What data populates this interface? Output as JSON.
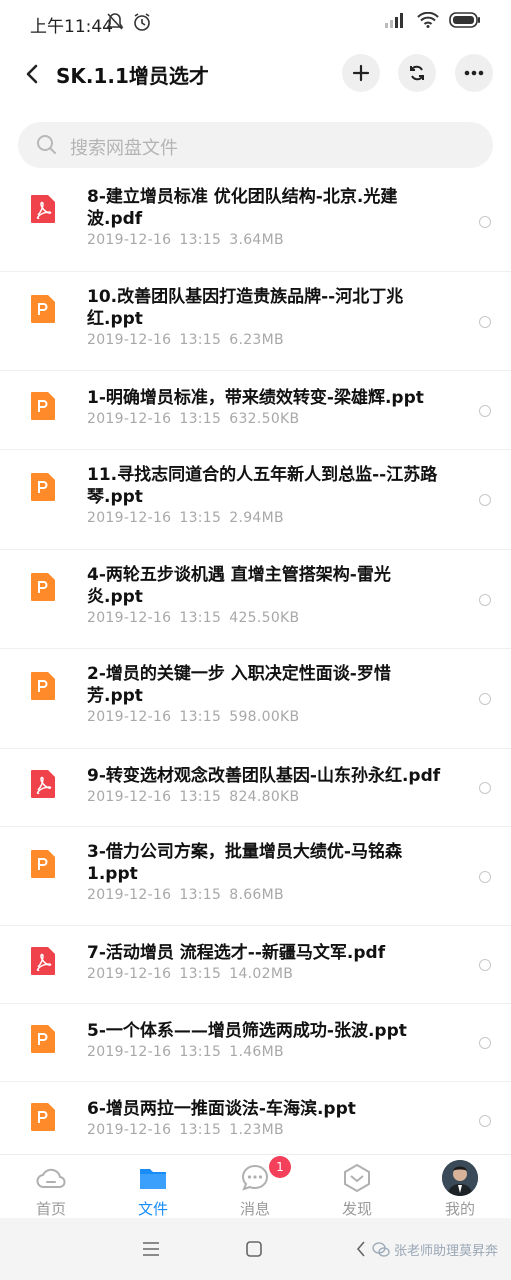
{
  "status_bar": {
    "time": "上午11:44",
    "icons": [
      "dnd-icon",
      "alarm-icon",
      "signal-icon",
      "wifi-icon",
      "battery-icon"
    ]
  },
  "header": {
    "title": "SK.1.1增员选才",
    "actions": [
      "add-icon",
      "refresh-icon",
      "more-icon"
    ]
  },
  "search": {
    "placeholder": "搜索网盘文件"
  },
  "files": [
    {
      "name": "8-建立增员标准 优化团队结构-北京.光建波.pdf",
      "name_lines": [
        "8-建立增员标准 优化团队结构-北京.光建",
        "波.pdf"
      ],
      "type": "pdf",
      "date": "2019-12-16",
      "time": "13:15",
      "size": "3.64MB"
    },
    {
      "name": "10.改善团队基因打造贵族品牌--河北丁兆红.ppt",
      "name_lines": [
        "10.改善团队基因打造贵族品牌--河北丁兆",
        "红.ppt"
      ],
      "type": "ppt",
      "date": "2019-12-16",
      "time": "13:15",
      "size": "6.23MB"
    },
    {
      "name": "1-明确增员标准，带来绩效转变-梁雄辉.ppt",
      "name_lines": [
        "1-明确增员标准，带来绩效转变-梁雄辉.ppt"
      ],
      "type": "ppt",
      "date": "2019-12-16",
      "time": "13:15",
      "size": "632.50KB"
    },
    {
      "name": "11.寻找志同道合的人五年新人到总监--江苏路琴.ppt",
      "name_lines": [
        "11.寻找志同道合的人五年新人到总监--江苏路",
        "琴.ppt"
      ],
      "type": "ppt",
      "date": "2019-12-16",
      "time": "13:15",
      "size": "2.94MB"
    },
    {
      "name": "4-两轮五步谈机遇 直增主管搭架构-雷光炎.ppt",
      "name_lines": [
        "4-两轮五步谈机遇 直增主管搭架构-雷光",
        "炎.ppt"
      ],
      "type": "ppt",
      "date": "2019-12-16",
      "time": "13:15",
      "size": "425.50KB"
    },
    {
      "name": "2-增员的关键一步 入职决定性面谈-罗惜芳.ppt",
      "name_lines": [
        "2-增员的关键一步 入职决定性面谈-罗惜",
        "芳.ppt"
      ],
      "type": "ppt",
      "date": "2019-12-16",
      "time": "13:15",
      "size": "598.00KB"
    },
    {
      "name": "9-转变选材观念改善团队基因-山东孙永红.pdf",
      "name_lines": [
        "9-转变选材观念改善团队基因-山东孙永红.pdf"
      ],
      "type": "pdf",
      "date": "2019-12-16",
      "time": "13:15",
      "size": "824.80KB"
    },
    {
      "name": "3-借力公司方案，批量增员大绩优-马铭森1.ppt",
      "name_lines": [
        "3-借力公司方案，批量增员大绩优-马铭森",
        "1.ppt"
      ],
      "type": "ppt",
      "date": "2019-12-16",
      "time": "13:15",
      "size": "8.66MB"
    },
    {
      "name": "7-活动增员 流程选才--新疆马文军.pdf",
      "name_lines": [
        "7-活动增员 流程选才--新疆马文军.pdf"
      ],
      "type": "pdf",
      "date": "2019-12-16",
      "time": "13:15",
      "size": "14.02MB"
    },
    {
      "name": "5-一个体系——增员筛选两成功-张波.ppt",
      "name_lines": [
        "5-一个体系——增员筛选两成功-张波.ppt"
      ],
      "type": "ppt",
      "date": "2019-12-16",
      "time": "13:15",
      "size": "1.46MB"
    },
    {
      "name": "6-增员两拉一推面谈法-车海滨.ppt",
      "name_lines": [
        "6-增员两拉一推面谈法-车海滨.ppt"
      ],
      "type": "ppt",
      "date": "2019-12-16",
      "time": "13:15",
      "size": "1.23MB"
    }
  ],
  "tabs": [
    {
      "label": "首页",
      "icon": "cloud-icon",
      "active": false
    },
    {
      "label": "文件",
      "icon": "folder-icon",
      "active": true
    },
    {
      "label": "消息",
      "icon": "message-icon",
      "active": false
    },
    {
      "label": "发现",
      "icon": "discover-icon",
      "active": false
    },
    {
      "label": "我的",
      "icon": "avatar",
      "active": false
    }
  ],
  "badge_count": "1",
  "watermark": "张老师助理莫昇奔",
  "colors": {
    "accent": "#1a8cf7",
    "pdf": "#f0424b",
    "ppt": "#ff8a2a",
    "badge": "#f5405b"
  }
}
